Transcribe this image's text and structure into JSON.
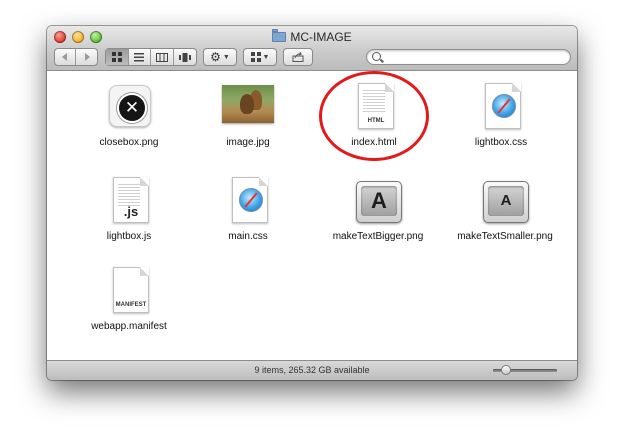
{
  "window": {
    "title": "MC-IMAGE"
  },
  "toolbar": {
    "back_icon": "back-arrow-icon",
    "forward_icon": "forward-arrow-icon",
    "views": [
      "icon-view",
      "list-view",
      "column-view",
      "coverflow-view"
    ],
    "action_icon": "gear-icon",
    "arrange_icon": "arrange-grid-icon",
    "share_icon": "share-icon",
    "search": {
      "placeholder": ""
    }
  },
  "files": [
    {
      "name": "closebox.png",
      "kind": "png"
    },
    {
      "name": "image.jpg",
      "kind": "jpg"
    },
    {
      "name": "index.html",
      "kind": "html",
      "tag": "HTML",
      "highlighted": true
    },
    {
      "name": "lightbox.css",
      "kind": "css"
    },
    {
      "name": "lightbox.js",
      "kind": "js",
      "tag": ".js"
    },
    {
      "name": "main.css",
      "kind": "css"
    },
    {
      "name": "makeTextBigger.png",
      "kind": "png",
      "glyph": "A"
    },
    {
      "name": "makeTextSmaller.png",
      "kind": "png",
      "glyph": "A"
    },
    {
      "name": "webapp.manifest",
      "kind": "manifest",
      "tag": "MANIFEST"
    }
  ],
  "status": {
    "text": "9 items, 265.32 GB available",
    "zoom_level": 0.15
  },
  "colors": {
    "highlight_ring": "#e21a1a",
    "traffic_close": "#e0443a",
    "traffic_minimize": "#f2b431",
    "traffic_zoom": "#65c03d"
  }
}
